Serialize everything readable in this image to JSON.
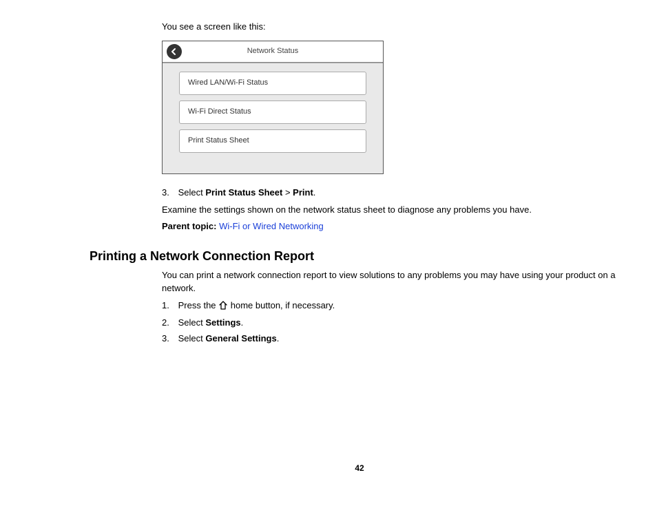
{
  "intro_text": "You see a screen like this:",
  "screen": {
    "title": "Network Status",
    "options": [
      "Wired LAN/Wi-Fi Status",
      "Wi-Fi Direct Status",
      "Print Status Sheet"
    ]
  },
  "step3": {
    "num": "3.",
    "prefix": "Select ",
    "bold1": "Print Status Sheet",
    "sep": " > ",
    "bold2": "Print",
    "suffix": "."
  },
  "examine_text": "Examine the settings shown on the network status sheet to diagnose any problems you have.",
  "parent_topic_label": "Parent topic: ",
  "parent_topic_link": "Wi-Fi or Wired Networking",
  "section2": {
    "heading": "Printing a Network Connection Report",
    "intro": "You can print a network connection report to view solutions to any problems you may have using your product on a network.",
    "step1": {
      "num": "1.",
      "prefix": "Press the ",
      "suffix": " home button, if necessary."
    },
    "step2": {
      "num": "2.",
      "prefix": "Select ",
      "bold": "Settings",
      "suffix": "."
    },
    "step3": {
      "num": "3.",
      "prefix": "Select ",
      "bold": "General Settings",
      "suffix": "."
    }
  },
  "page_number": "42"
}
